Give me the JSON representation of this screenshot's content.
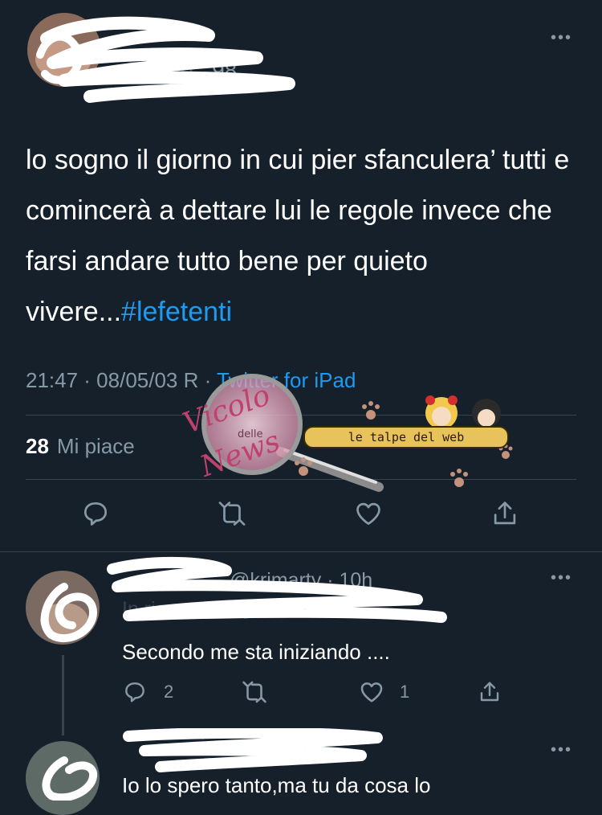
{
  "main_tweet": {
    "handle_fragment": "98",
    "more_label": "•••",
    "text": "lo sogno il giorno in cui pier sfanculera’ tutti e comincerà a dettare lui le regole invece che farsi andare tutto bene per quieto vivere...",
    "hashtag": "#lefetenti",
    "timestamp": "21:47 · 08/05/03 R · ",
    "source": "Twitter for iPad",
    "likes_count": "28",
    "likes_label": "Mi piace"
  },
  "watermark": {
    "script_top": "Vicolo",
    "script_mid": "delle",
    "script_bottom": "News",
    "banner": "le talpe del web"
  },
  "replies": [
    {
      "handle": "@krimarty · 10h",
      "reply_to_fragment": "98",
      "text": "Secondo me sta iniziando ....",
      "reply_count": "2",
      "like_count": "1",
      "more_label": "•••"
    },
    {
      "text": "Io lo spero tanto,ma tu da cosa lo",
      "more_label": "•••"
    }
  ],
  "colors": {
    "background": "#15202b",
    "secondary_text": "#8899a6",
    "link": "#1d9bf0",
    "divider": "#38444d"
  },
  "icons": [
    "reply-icon",
    "retweet-icon",
    "like-icon",
    "share-icon",
    "more-icon"
  ]
}
